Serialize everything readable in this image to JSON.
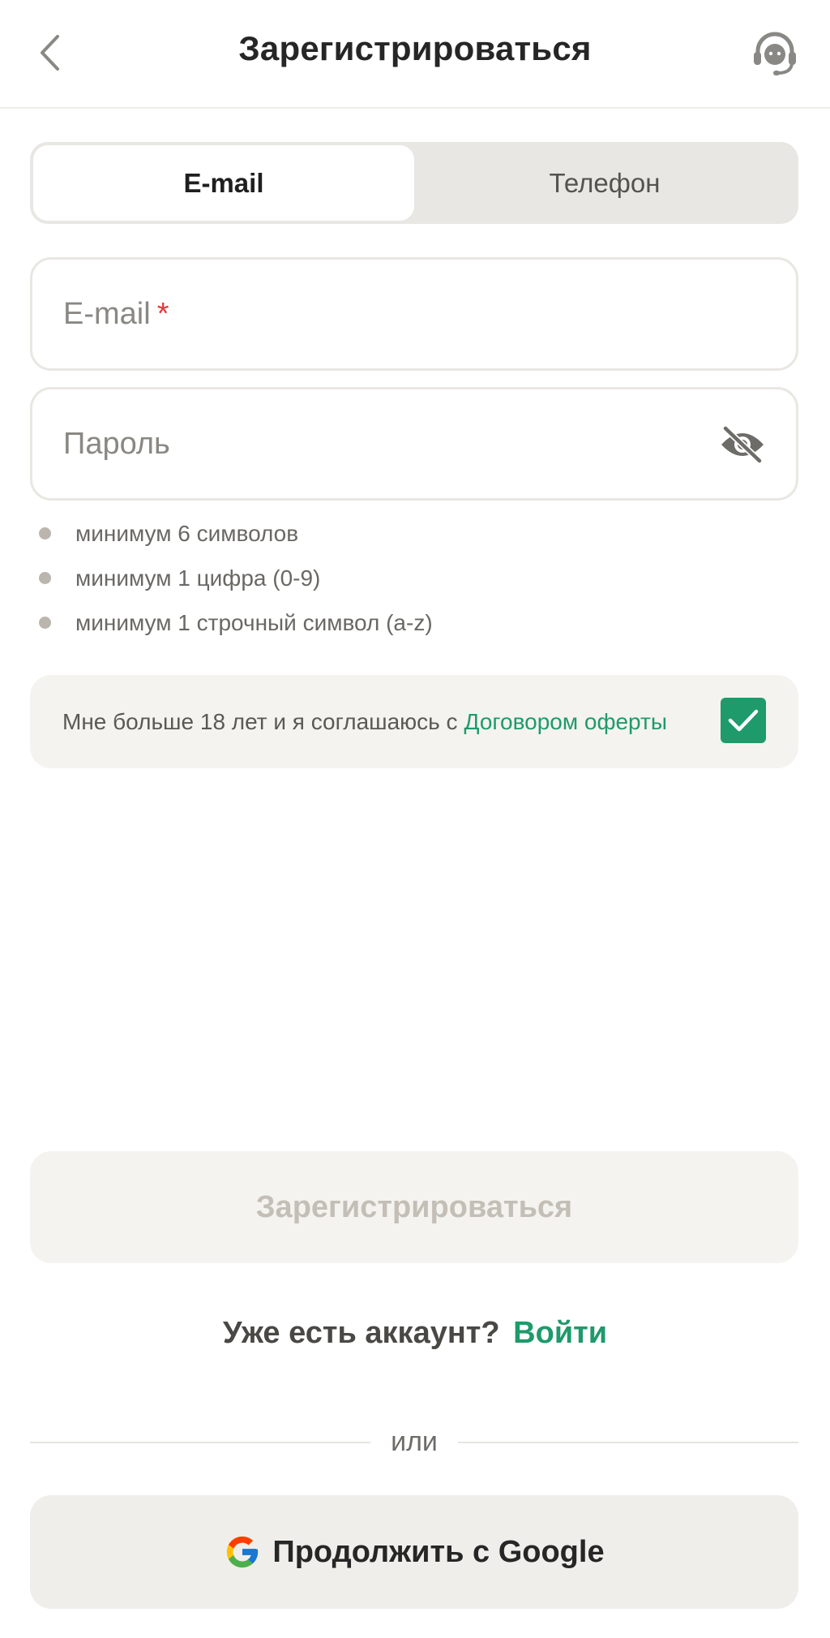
{
  "header": {
    "title": "Зарегистрироваться"
  },
  "tabs": [
    {
      "label": "E-mail",
      "active": true
    },
    {
      "label": "Телефон",
      "active": false
    }
  ],
  "email_field": {
    "placeholder": "E-mail",
    "required_mark": "*",
    "value": ""
  },
  "password_field": {
    "placeholder": "Пароль",
    "value": ""
  },
  "password_rules": [
    "минимум 6 символов",
    "минимум 1 цифра (0-9)",
    "минимум 1 строчный символ (a-z)"
  ],
  "agreement": {
    "text": "Мне больше 18 лет и я соглашаюсь с",
    "link": "Договором оферты",
    "checked": true
  },
  "submit_label": "Зарегистрироваться",
  "login_prompt": {
    "question": "Уже есть аккаунт?",
    "link": "Войти"
  },
  "divider_text": "или",
  "google_label": "Продолжить с Google",
  "colors": {
    "accent": "#1f9a6b",
    "required": "#e23b3b",
    "disabled_text": "#c3bfb6"
  }
}
